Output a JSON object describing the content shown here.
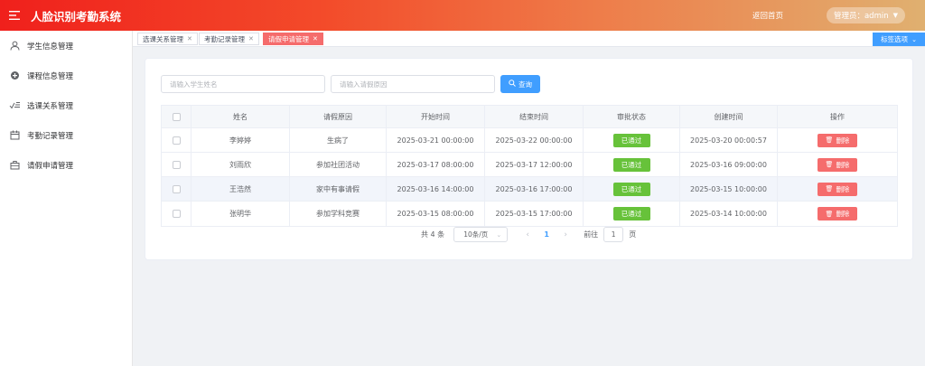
{
  "header": {
    "title": "人脸识别考勤系统",
    "home_label": "返回首页",
    "user_label": "管理员：admin"
  },
  "sidebar": {
    "items": [
      {
        "label": "学生信息管理",
        "icon": "user-icon"
      },
      {
        "label": "课程信息管理",
        "icon": "course-icon"
      },
      {
        "label": "选课关系管理",
        "icon": "selection-icon"
      },
      {
        "label": "考勤记录管理",
        "icon": "calendar-icon"
      },
      {
        "label": "请假申请管理",
        "icon": "briefcase-icon"
      }
    ]
  },
  "tabs": {
    "items": [
      {
        "label": "选课关系管理",
        "active": false
      },
      {
        "label": "考勤记录管理",
        "active": false
      },
      {
        "label": "请假申请管理",
        "active": true
      }
    ],
    "options_label": "标签选项"
  },
  "search": {
    "name_placeholder": "请输入学生姓名",
    "reason_placeholder": "请输入请假原因",
    "query_label": "查询"
  },
  "table": {
    "headers": [
      "姓名",
      "请假原因",
      "开始时间",
      "结束时间",
      "审批状态",
      "创建时间",
      "操作"
    ],
    "rows": [
      {
        "name": "李婷婷",
        "reason": "生病了",
        "start": "2025-03-21 00:00:00",
        "end": "2025-03-22 00:00:00",
        "status": "已通过",
        "created": "2025-03-20 00:00:57",
        "action": "删除"
      },
      {
        "name": "刘雨欣",
        "reason": "参加社团活动",
        "start": "2025-03-17 08:00:00",
        "end": "2025-03-17 12:00:00",
        "status": "已通过",
        "created": "2025-03-16 09:00:00",
        "action": "删除"
      },
      {
        "name": "王浩然",
        "reason": "家中有事请假",
        "start": "2025-03-16 14:00:00",
        "end": "2025-03-16 17:00:00",
        "status": "已通过",
        "created": "2025-03-15 10:00:00",
        "action": "删除"
      },
      {
        "name": "张明华",
        "reason": "参加学科竞赛",
        "start": "2025-03-15 08:00:00",
        "end": "2025-03-15 17:00:00",
        "status": "已通过",
        "created": "2025-03-14 10:00:00",
        "action": "删除"
      }
    ]
  },
  "pagination": {
    "total": "共 4 条",
    "page_size": "10条/页",
    "current_page": "1",
    "goto_label": "前往",
    "goto_value": "1",
    "page_unit": "页"
  },
  "colors": {
    "primary": "#409eff",
    "success": "#67c23a",
    "danger": "#f56c6c",
    "header_start": "#f0201c",
    "header_end": "#e0b070"
  }
}
